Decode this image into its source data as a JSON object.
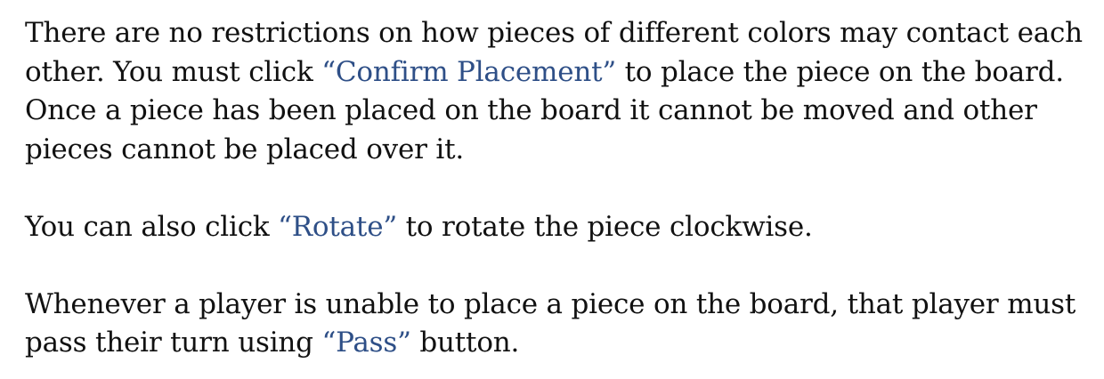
{
  "document": {
    "paragraph1": {
      "text_before_confirm": "There are no restrictions on how pieces of different colors may contact each other. You must click ",
      "confirm_label": "“Confirm Placement”",
      "text_after_confirm": " to place the piece on the board. Once a piece has been placed on the board it cannot be moved and other pieces cannot be placed over it."
    },
    "paragraph2": {
      "text_before_rotate": "You can also click ",
      "rotate_label": "“Rotate”",
      "text_after_rotate": " to rotate the piece clockwise."
    },
    "paragraph3": {
      "text_before_pass": "Whenever a player is unable to place a piece on the board, that player must pass their turn using ",
      "pass_label": "“Pass”",
      "text_after_pass": " button."
    }
  },
  "colors": {
    "text": "#111111",
    "highlight": "#2e4f87",
    "background": "#ffffff"
  }
}
